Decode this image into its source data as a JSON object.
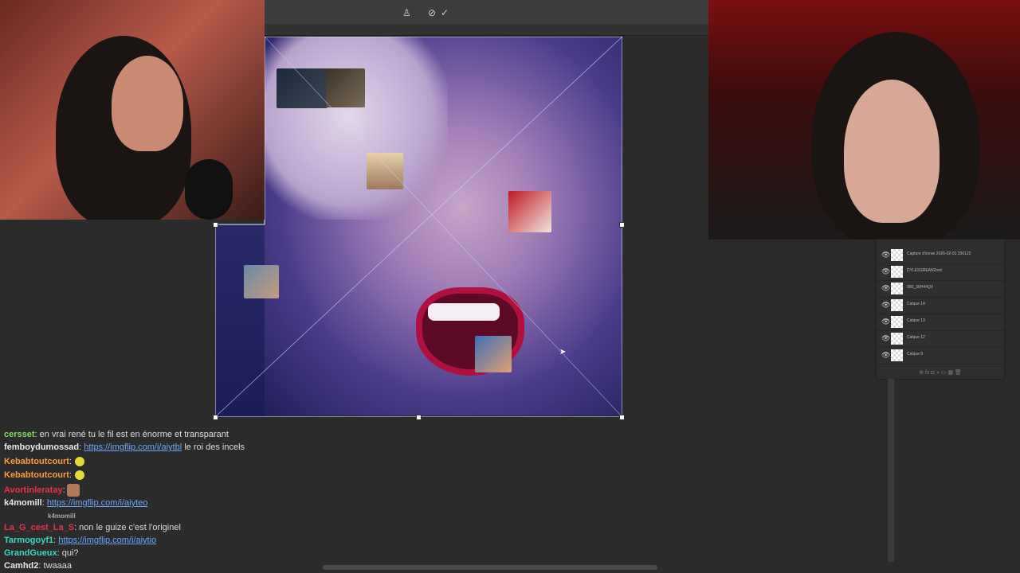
{
  "colors": {
    "user_green": "#7fdc5a",
    "user_orange": "#ff9a3c",
    "user_red": "#e6334a",
    "user_white": "#e8e8e8",
    "user_teal": "#3fd7c2",
    "link": "#6aa6ff"
  },
  "toolbar": {
    "icons": [
      "warp-icon",
      "cancel-icon",
      "commit-icon"
    ]
  },
  "layers": [
    {
      "name": "Capture d'écran 2026-02-01 200122"
    },
    {
      "name": "DYLESSREAN2red"
    },
    {
      "name": "000_36H44QV"
    },
    {
      "name": "Calque 14"
    },
    {
      "name": "Calque 13"
    },
    {
      "name": "Calque 12"
    },
    {
      "name": "Calque 9"
    }
  ],
  "chat": [
    {
      "user": "cersset",
      "sep": ":",
      "text": " en vrai rené tu le fil est en énorme et transparant",
      "color": "user_green"
    },
    {
      "user": "femboydumossad",
      "sep": ":",
      "link": "https://imgflip.com/i/aiytbl",
      "text": " le roi des incels",
      "color": "user_white"
    },
    {
      "user": "Kebabtoutcourt",
      "sep": ":",
      "emote": "emote-icon",
      "color": "user_orange"
    },
    {
      "user": "Kebabtoutcourt",
      "sep": ":",
      "emote": "emote-icon",
      "color": "user_orange"
    },
    {
      "user": "Avortinleratay",
      "sep": ":",
      "emote": "emote-image",
      "color": "user_red"
    },
    {
      "user": "k4momill",
      "sep": ":",
      "link": "https://imgflip.com/i/aiyteo",
      "color": "user_white"
    },
    {
      "user": "La_G_cest_La_S",
      "sep": ":",
      "text": " non le guize c'est l'originel",
      "color": "user_red"
    },
    {
      "user": "Tarmogoyf1",
      "sep": ":",
      "link": "https://imgflip.com/i/aiytio",
      "color": "user_teal"
    },
    {
      "user": "GrandGueux",
      "sep": ":",
      "text": " qui?",
      "color": "user_teal"
    },
    {
      "user": "Camhd2",
      "sep": ":",
      "text": " twaaaa",
      "color": "user_white"
    }
  ],
  "chat_sub_label": "k4momill"
}
